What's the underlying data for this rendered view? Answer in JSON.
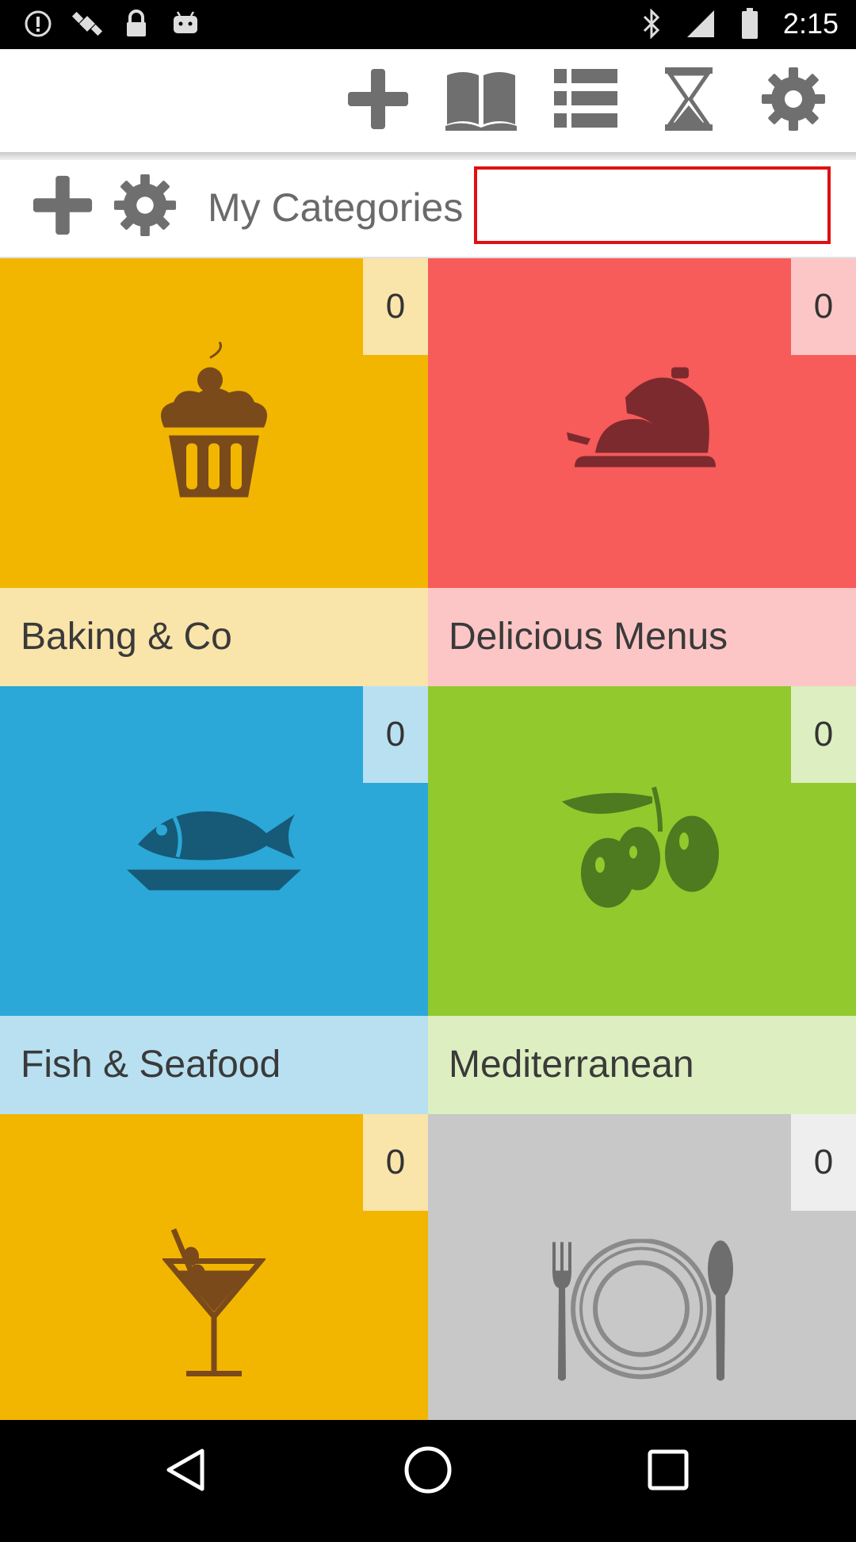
{
  "status_bar": {
    "time": "2:15",
    "icons": [
      "alert-icon",
      "fake-gps-icon",
      "lock-icon",
      "android-icon",
      "bluetooth-icon",
      "signal-icon",
      "battery-icon"
    ]
  },
  "toolbar": {
    "buttons": [
      "add-icon",
      "book-icon",
      "list-icon",
      "hourglass-icon",
      "gear-icon"
    ]
  },
  "category_bar": {
    "title": "My Categories",
    "search_value": ""
  },
  "categories": [
    {
      "label": "Baking & Co",
      "count": "0",
      "icon": "cupcake-icon",
      "color": "#F2B600",
      "label_bg": "#F9E4AA",
      "count_bg": "#F9E4AA"
    },
    {
      "label": "Delicious Menus",
      "count": "0",
      "icon": "cloche-icon",
      "color": "#F75B5A",
      "label_bg": "#FCC6C6",
      "count_bg": "#FCC6C6"
    },
    {
      "label": "Fish & Seafood",
      "count": "0",
      "icon": "fish-icon",
      "color": "#2BA8D8",
      "label_bg": "#B8E0F1",
      "count_bg": "#B8E0F1"
    },
    {
      "label": "Mediterranean",
      "count": "0",
      "icon": "olive-icon",
      "color": "#92C92D",
      "label_bg": "#DDEEC0",
      "count_bg": "#DDEEC0"
    },
    {
      "label": "",
      "count": "0",
      "icon": "cocktail-icon",
      "color": "#F2B600",
      "label_bg": "#F9E4AA",
      "count_bg": "#F9E4AA"
    },
    {
      "label": "",
      "count": "0",
      "icon": "plate-cutlery-icon",
      "color": "#C8C8C8",
      "label_bg": "#E6E6E6",
      "count_bg": "#EEEEEE"
    }
  ],
  "nav": [
    "back-icon",
    "home-icon",
    "recents-icon"
  ]
}
